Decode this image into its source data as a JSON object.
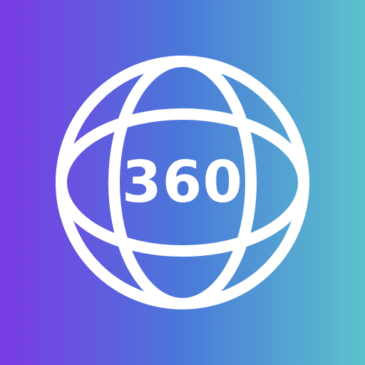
{
  "icon": {
    "label": "360",
    "symbol": "globe-icon",
    "colors": {
      "gradient_start": "#7b3ae4",
      "gradient_mid": "#4a78d9",
      "gradient_end": "#5cc3cc",
      "foreground": "#ffffff"
    }
  }
}
